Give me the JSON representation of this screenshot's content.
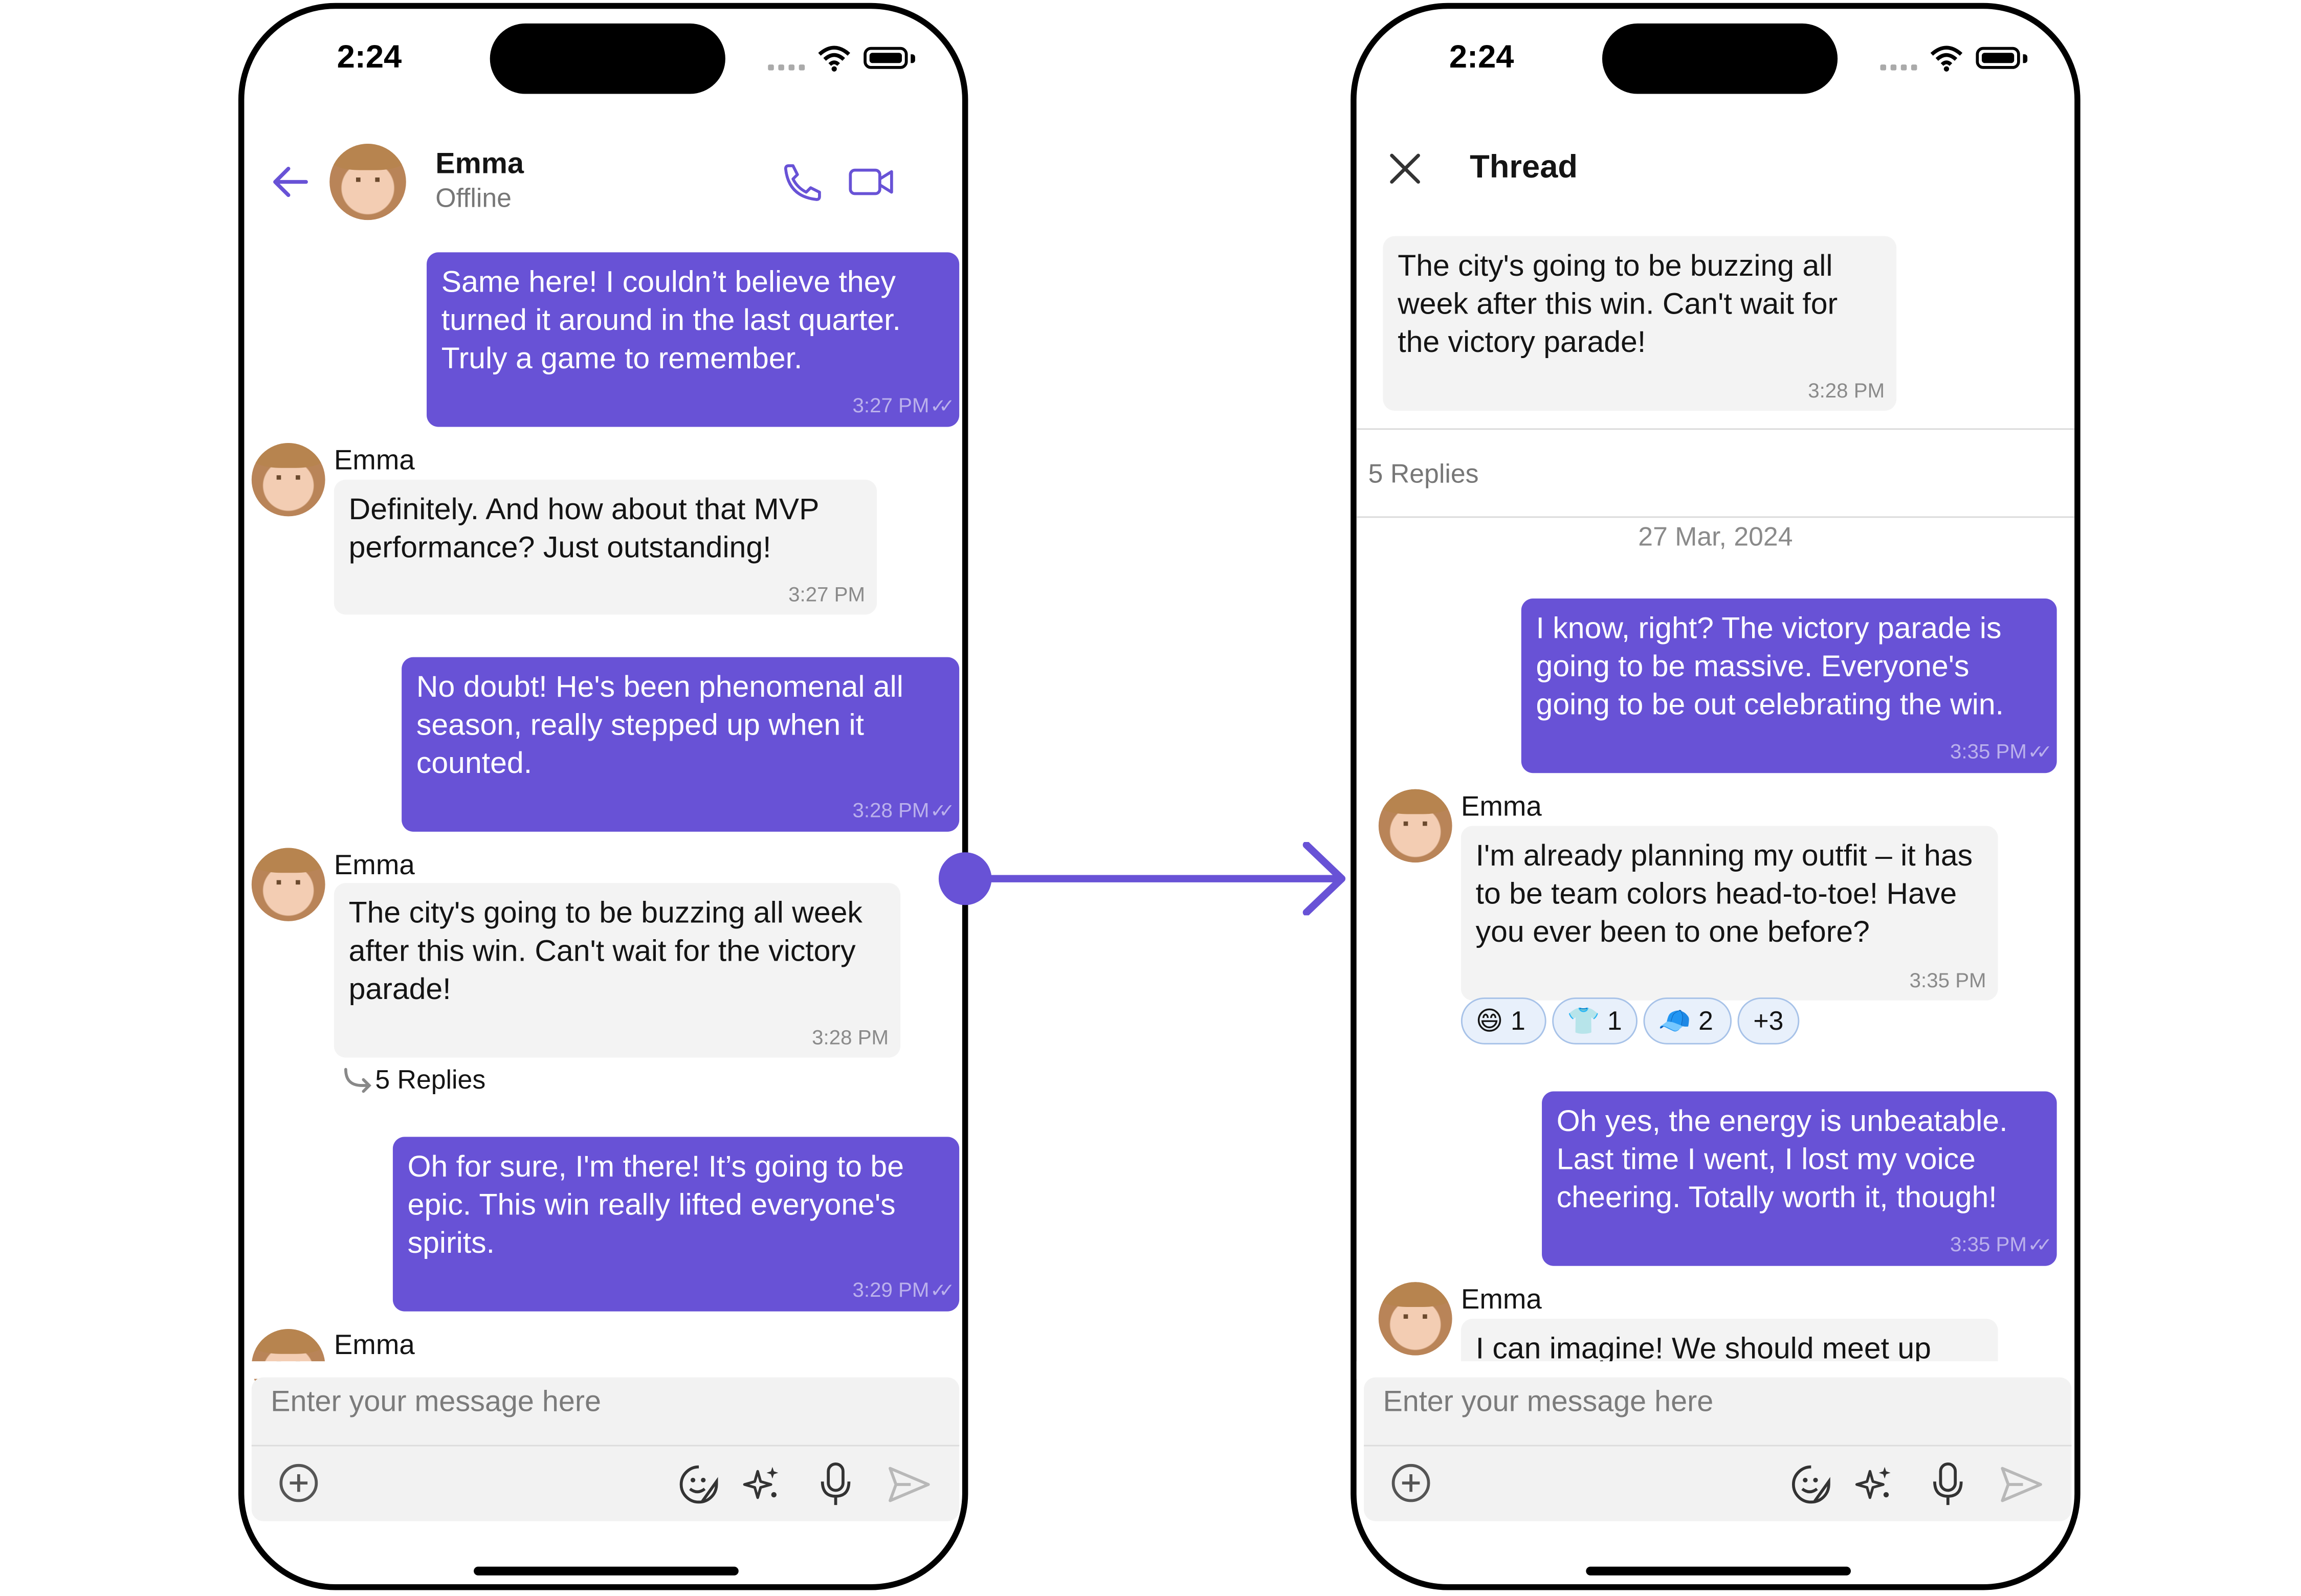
{
  "colors": {
    "accent": "#6852d6",
    "incoming_bubble": "#f3f3f3",
    "outgoing_text": "#ffffff",
    "muted": "#8a8a8a"
  },
  "status_bar": {
    "time": "2:24"
  },
  "left_screen": {
    "header": {
      "name": "Emma",
      "status": "Offline",
      "icons": [
        "back-arrow-icon",
        "phone-call-icon",
        "video-call-icon"
      ]
    },
    "messages": [
      {
        "direction": "outgoing",
        "text": "Same here! I couldn’t believe they turned it around in the last quarter. Truly a game to remember.",
        "time": "3:27 PM"
      },
      {
        "direction": "incoming",
        "sender": "Emma",
        "text": "Definitely. And how about that MVP performance? Just outstanding!",
        "time": "3:27 PM"
      },
      {
        "direction": "outgoing",
        "text": "No doubt! He's been phenomenal all season, really stepped up when it counted.",
        "time": "3:28 PM"
      },
      {
        "direction": "incoming",
        "sender": "Emma",
        "text": "The city's going to be buzzing all week after this win. Can't wait for the victory parade!",
        "time": "3:28 PM",
        "replies": "5 Replies"
      },
      {
        "direction": "outgoing",
        "text": "Oh for sure, I'm there! It’s going to be epic. This win really lifted everyone's spirits.",
        "time": "3:29 PM"
      },
      {
        "direction": "incoming",
        "sender": "Emma"
      }
    ],
    "composer": {
      "placeholder": "Enter your message here"
    }
  },
  "right_screen": {
    "header": {
      "title": "Thread"
    },
    "parent_message": {
      "text": "The city's going to be buzzing all week after this win. Can't wait for the victory parade!",
      "time": "3:28 PM"
    },
    "reply_count": "5 Replies",
    "date_separator": "27 Mar, 2024",
    "messages": [
      {
        "direction": "outgoing",
        "text": "I know, right? The victory parade is going to be massive. Everyone's going to be out celebrating the win.",
        "time": "3:35 PM"
      },
      {
        "direction": "incoming",
        "sender": "Emma",
        "text": "I'm already planning my outfit – it has to be team colors head-to-toe! Have you ever been to one before?",
        "time": "3:35 PM",
        "reactions": [
          {
            "emoji": "😄",
            "count": "1"
          },
          {
            "emoji": "👕",
            "count": "1"
          },
          {
            "emoji": "🧢",
            "count": "2"
          },
          {
            "emoji": "",
            "count": "+3"
          }
        ]
      },
      {
        "direction": "outgoing",
        "text": "Oh yes, the energy is unbeatable. Last time I went, I lost my voice cheering. Totally worth it, though!",
        "time": "3:35 PM"
      },
      {
        "direction": "incoming",
        "sender": "Emma",
        "text": "I can imagine! We should meet up"
      }
    ],
    "composer": {
      "placeholder": "Enter your message here"
    }
  }
}
